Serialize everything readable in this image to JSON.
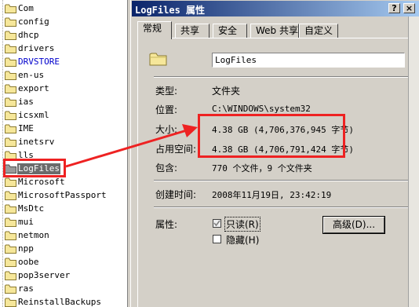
{
  "tree": {
    "items": [
      {
        "label": "Com"
      },
      {
        "label": "config"
      },
      {
        "label": "dhcp"
      },
      {
        "label": "drivers"
      },
      {
        "label": "DRVSTORE",
        "color": "#0000cc"
      },
      {
        "label": "en-us"
      },
      {
        "label": "export"
      },
      {
        "label": "ias"
      },
      {
        "label": "icsxml"
      },
      {
        "label": "IME"
      },
      {
        "label": "inetsrv"
      },
      {
        "label": "lls"
      },
      {
        "label": "LogFiles",
        "selected": true
      },
      {
        "label": "Microsoft"
      },
      {
        "label": "MicrosoftPassport"
      },
      {
        "label": "MsDtc"
      },
      {
        "label": "mui"
      },
      {
        "label": "netmon"
      },
      {
        "label": "npp"
      },
      {
        "label": "oobe"
      },
      {
        "label": "pop3server"
      },
      {
        "label": "ras"
      },
      {
        "label": "ReinstallBackups"
      }
    ]
  },
  "dialog": {
    "title": "LogFiles 属性",
    "buttons": {
      "help": "?",
      "close": "×"
    },
    "tabs": [
      {
        "label": "常规",
        "active": true
      },
      {
        "label": "共享"
      },
      {
        "label": "安全"
      },
      {
        "label": "Web 共享"
      },
      {
        "label": "自定义"
      }
    ],
    "general": {
      "folder_icon": "folder-icon",
      "name_value": "LogFiles",
      "type_label": "类型:",
      "type_value": "文件夹",
      "location_label": "位置:",
      "location_value": "C:\\WINDOWS\\system32",
      "size_label": "大小:",
      "size_value": "4.38 GB (4,706,376,945 字节)",
      "size_on_disk_label": "占用空间:",
      "size_on_disk_value": "4.38 GB (4,706,791,424 字节)",
      "contains_label": "包含:",
      "contains_value": "770 个文件，9 个文件夹",
      "created_label": "创建时间:",
      "created_value": "2008年11月19日, 23:42:19",
      "attributes_label": "属性:",
      "readonly_label": "只读(R)",
      "readonly_state": "checked-grayed",
      "hidden_label": "隐藏(H)",
      "hidden_state": "unchecked",
      "advanced_label": "高级(D)..."
    }
  },
  "colors": {
    "highlight_box": "#ee2222",
    "titlebar_start": "#0a246a",
    "titlebar_end": "#a6caf0",
    "dialog_bg": "#d4d0c8"
  }
}
